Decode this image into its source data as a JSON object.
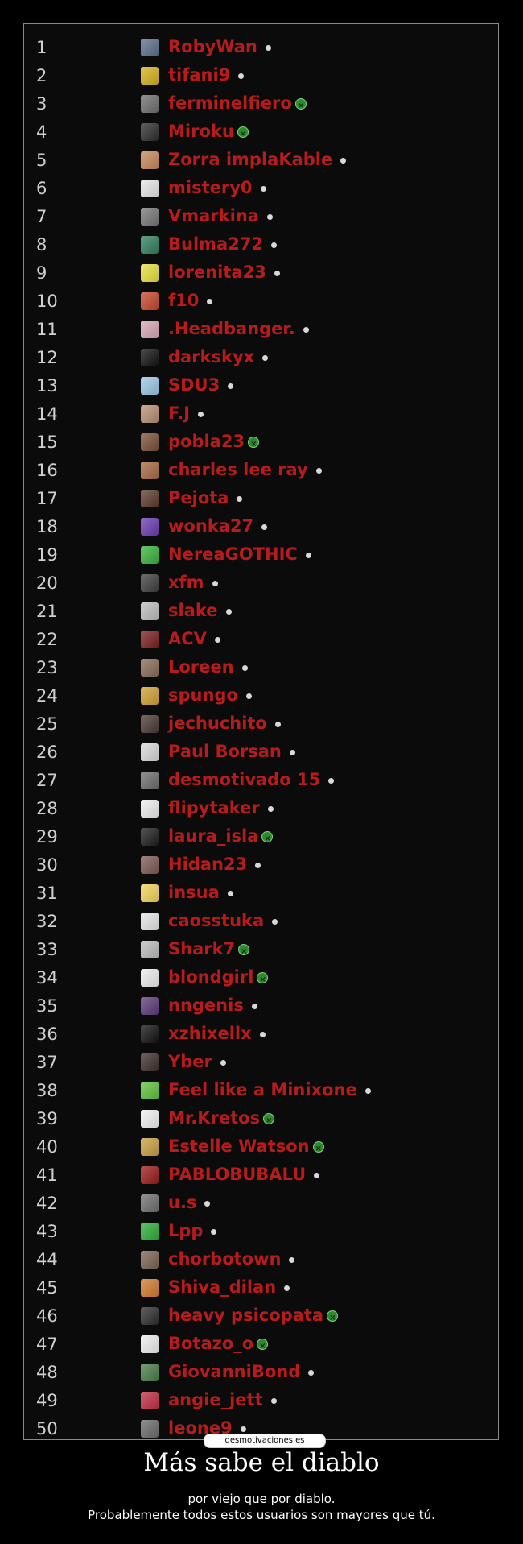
{
  "watermark": "desmotivaciones.es",
  "title": "Más sabe el diablo",
  "subtitle": "por viejo que por diablo.",
  "subtitle2": "Probablemente todos estos usuarios son mayores que tú.",
  "colors": {
    "username": "#b81b1b",
    "rank": "#cfcfcf",
    "badge": "#2f8a2f"
  },
  "rows": [
    {
      "rank": "1",
      "name": "RobyWan",
      "status": "dot",
      "avatar": "#5c6f8a"
    },
    {
      "rank": "2",
      "name": "tifani9",
      "status": "dot",
      "avatar": "#d6b21b"
    },
    {
      "rank": "3",
      "name": "ferminelfiero",
      "status": "badge",
      "avatar": "#6f6f6f"
    },
    {
      "rank": "4",
      "name": "Miroku",
      "status": "badge",
      "avatar": "#2d2d2d"
    },
    {
      "rank": "5",
      "name": "Zorra implaKable",
      "status": "dot",
      "avatar": "#c78857"
    },
    {
      "rank": "6",
      "name": "mistery0",
      "status": "dot",
      "avatar": "#e6e6e6"
    },
    {
      "rank": "7",
      "name": "Vmarkina",
      "status": "dot",
      "avatar": "#777"
    },
    {
      "rank": "8",
      "name": "Bulma272",
      "status": "dot",
      "avatar": "#2f7f5f"
    },
    {
      "rank": "9",
      "name": "lorenita23",
      "status": "dot",
      "avatar": "#e8e03c"
    },
    {
      "rank": "10",
      "name": "f10",
      "status": "dot",
      "avatar": "#c7462b"
    },
    {
      "rank": "11",
      "name": ".Headbanger.",
      "status": "dot",
      "avatar": "#d8a7b5"
    },
    {
      "rank": "12",
      "name": "darkskyx",
      "status": "dot",
      "avatar": "#111"
    },
    {
      "rank": "13",
      "name": "SDU3",
      "status": "dot",
      "avatar": "#9cc7e6"
    },
    {
      "rank": "14",
      "name": "F.J",
      "status": "dot",
      "avatar": "#b78f74"
    },
    {
      "rank": "15",
      "name": "pobla23",
      "status": "badge",
      "avatar": "#7a4f37"
    },
    {
      "rank": "16",
      "name": "charles lee ray",
      "status": "dot",
      "avatar": "#a76a3f"
    },
    {
      "rank": "17",
      "name": "Pejota",
      "status": "dot",
      "avatar": "#5c3a2d"
    },
    {
      "rank": "18",
      "name": "wonka27",
      "status": "dot",
      "avatar": "#6a3bb0"
    },
    {
      "rank": "19",
      "name": "NereaGOTHIC",
      "status": "dot",
      "avatar": "#39b33b"
    },
    {
      "rank": "20",
      "name": "xfm",
      "status": "dot",
      "avatar": "#3e3e3e"
    },
    {
      "rank": "21",
      "name": "slake",
      "status": "dot",
      "avatar": "#bdbdbd"
    },
    {
      "rank": "22",
      "name": "ACV",
      "status": "dot",
      "avatar": "#7a1f1f"
    },
    {
      "rank": "23",
      "name": "Loreen",
      "status": "dot",
      "avatar": "#8a6b56"
    },
    {
      "rank": "24",
      "name": "spungo",
      "status": "dot",
      "avatar": "#d0a033"
    },
    {
      "rank": "25",
      "name": "jechuchito",
      "status": "dot",
      "avatar": "#4a3a32"
    },
    {
      "rank": "26",
      "name": "Paul Borsan",
      "status": "dot",
      "avatar": "#d9d9d9"
    },
    {
      "rank": "27",
      "name": "desmotivado 15",
      "status": "dot",
      "avatar": "#6e6e6e"
    },
    {
      "rank": "28",
      "name": "flipytaker",
      "status": "dot",
      "avatar": "#efefef"
    },
    {
      "rank": "29",
      "name": "laura_isla",
      "status": "badge",
      "avatar": "#1d1d1d"
    },
    {
      "rank": "30",
      "name": "Hidan23",
      "status": "dot",
      "avatar": "#7d5a52"
    },
    {
      "rank": "31",
      "name": "insua",
      "status": "dot",
      "avatar": "#f1d45a"
    },
    {
      "rank": "32",
      "name": "caosstuka",
      "status": "dot",
      "avatar": "#e6e6e6"
    },
    {
      "rank": "33",
      "name": "Shark7",
      "status": "badge",
      "avatar": "#bcbcbc"
    },
    {
      "rank": "34",
      "name": "blondgirl",
      "status": "badge",
      "avatar": "#ededed"
    },
    {
      "rank": "35",
      "name": "nngenis",
      "status": "dot",
      "avatar": "#5b3b7a"
    },
    {
      "rank": "36",
      "name": "xzhixellx",
      "status": "dot",
      "avatar": "#111"
    },
    {
      "rank": "37",
      "name": "Yber",
      "status": "dot",
      "avatar": "#3c2f2b"
    },
    {
      "rank": "38",
      "name": "Feel like a Minixone",
      "status": "dot",
      "avatar": "#5ec33c"
    },
    {
      "rank": "39",
      "name": "Mr.Kretos",
      "status": "badge",
      "avatar": "#f2f2f2"
    },
    {
      "rank": "40",
      "name": "Estelle Watson",
      "status": "badge",
      "avatar": "#c9a042"
    },
    {
      "rank": "41",
      "name": "PABLOBUBALU",
      "status": "dot",
      "avatar": "#9a1b1b"
    },
    {
      "rank": "42",
      "name": "u.s",
      "status": "dot",
      "avatar": "#6f6f6f"
    },
    {
      "rank": "43",
      "name": "Lpp",
      "status": "dot",
      "avatar": "#2eae3a"
    },
    {
      "rank": "44",
      "name": "chorbotown",
      "status": "dot",
      "avatar": "#7a6454"
    },
    {
      "rank": "45",
      "name": "Shiva_dilan",
      "status": "dot",
      "avatar": "#d27b2e"
    },
    {
      "rank": "46",
      "name": "heavy psicopata",
      "status": "badge",
      "avatar": "#2d2d2d"
    },
    {
      "rank": "47",
      "name": "Botazo_o",
      "status": "badge",
      "avatar": "#efefef"
    },
    {
      "rank": "48",
      "name": "GiovanniBond",
      "status": "dot",
      "avatar": "#4a7d4a"
    },
    {
      "rank": "49",
      "name": "angie_jett",
      "status": "dot",
      "avatar": "#c32d45"
    },
    {
      "rank": "50",
      "name": "leone9",
      "status": "dot",
      "avatar": "#6b6b6b"
    }
  ]
}
